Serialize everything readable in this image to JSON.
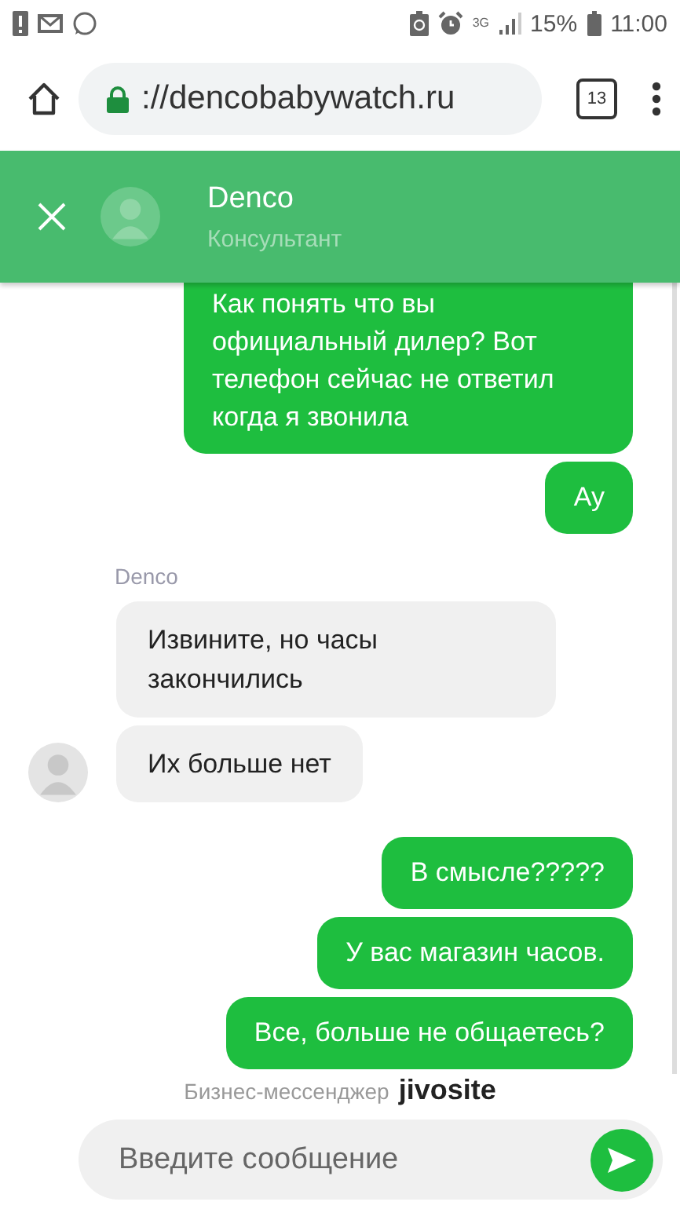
{
  "status_bar": {
    "network": "3G",
    "battery": "15%",
    "time": "11:00"
  },
  "browser": {
    "url": "://dencobabywatch.ru",
    "tab_count": "13"
  },
  "chat_header": {
    "name": "Denco",
    "role": "Консультант"
  },
  "messages": [
    {
      "kind": "outgoing",
      "text": "Как понять что вы официальный дилер? Вот телефон сейчас не ответил когда я звонила"
    },
    {
      "kind": "outgoing",
      "text": "Ау"
    },
    {
      "kind": "sender",
      "text": "Denco"
    },
    {
      "kind": "incoming",
      "text": "Извините, но часы закончились",
      "avatar": false
    },
    {
      "kind": "incoming",
      "text": "Их больше нет",
      "avatar": true
    },
    {
      "kind": "outgoing",
      "text": "В смысле?????"
    },
    {
      "kind": "outgoing",
      "text": "У вас магазин часов."
    },
    {
      "kind": "outgoing",
      "text": "Все, больше не общаетесь?"
    }
  ],
  "footer": {
    "powered_by": "Бизнес-мессенджер",
    "brand": "jivosite",
    "input": {
      "placeholder": "Введите сообщение"
    }
  }
}
